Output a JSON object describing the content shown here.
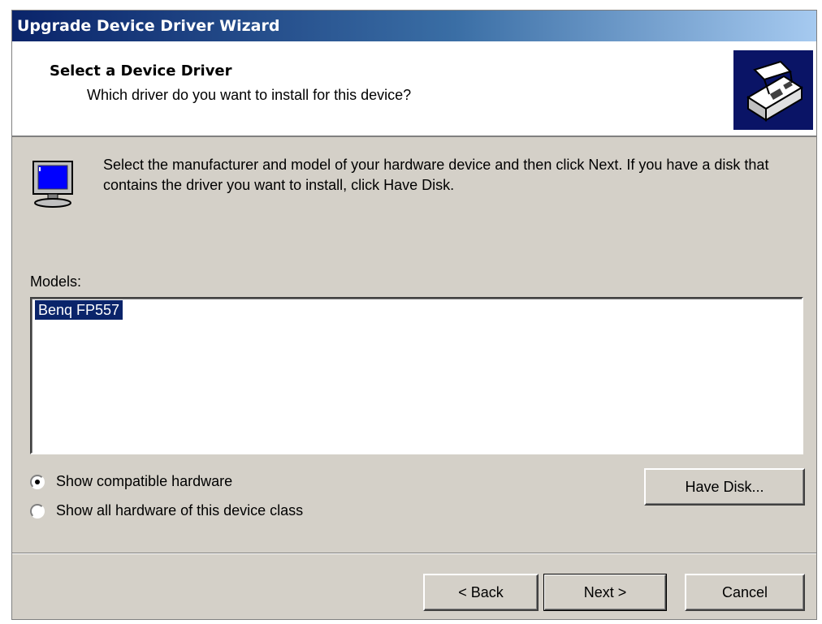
{
  "window": {
    "title": "Upgrade Device Driver Wizard"
  },
  "header": {
    "title": "Select a Device Driver",
    "subtitle": "Which driver do you want to install for this device?"
  },
  "instructions": "Select the manufacturer and model of your hardware device and then click Next. If you have a disk that contains the driver you want to install, click Have Disk.",
  "models": {
    "label": "Models:",
    "items": [
      "Benq FP557"
    ],
    "selected": "Benq FP557"
  },
  "options": {
    "compatible": "Show compatible hardware",
    "all_hardware": "Show all hardware of this device class",
    "selected": "compatible"
  },
  "buttons": {
    "have_disk": "Have Disk...",
    "back": "< Back",
    "next": "Next >",
    "cancel": "Cancel"
  },
  "colors": {
    "title_bar": "#0a246a",
    "selection": "#0a246a",
    "dialog_face": "#d4d0c8"
  },
  "icons": {
    "header": "hardware-card-icon",
    "info": "monitor-icon"
  }
}
